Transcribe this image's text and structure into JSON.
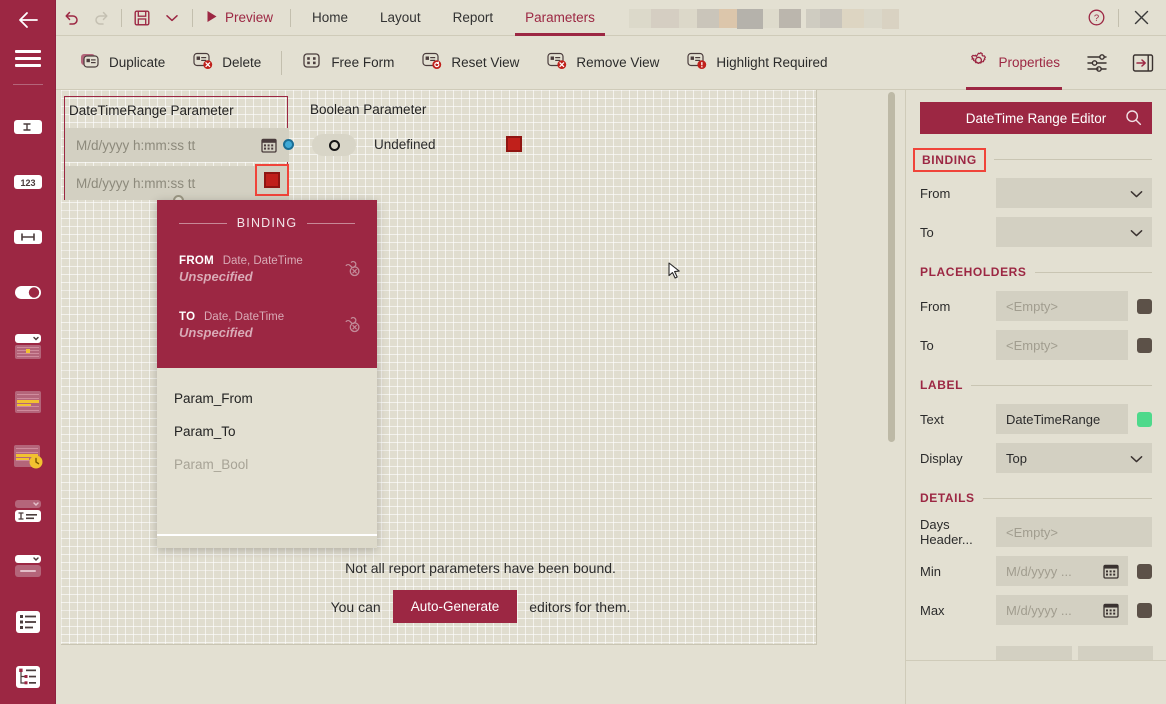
{
  "titlebar": {
    "back_icon": "back-arrow-icon",
    "undo_icon": "undo-icon",
    "redo_icon": "redo-icon",
    "save_icon": "save-icon",
    "save_dropdown_icon": "chevron-down-icon",
    "preview_label": "Preview",
    "preview_icon": "play-icon",
    "tabs": [
      {
        "label": "Home",
        "active": false
      },
      {
        "label": "Layout",
        "active": false
      },
      {
        "label": "Report",
        "active": false
      },
      {
        "label": "Parameters",
        "active": true
      }
    ],
    "help_icon": "help-circle-icon",
    "close_icon": "close-icon"
  },
  "ribbon": {
    "items": [
      {
        "label": "Duplicate",
        "icon": "duplicate-parameter-icon",
        "accent": false
      },
      {
        "label": "Delete",
        "icon": "delete-parameter-icon",
        "accent": false
      },
      {
        "label": "Free Form",
        "icon": "free-form-icon",
        "accent": false
      },
      {
        "label": "Reset View",
        "icon": "reset-view-icon",
        "accent": false
      },
      {
        "label": "Remove View",
        "icon": "remove-view-icon",
        "accent": false
      },
      {
        "label": "Highlight Required",
        "icon": "highlight-required-icon",
        "accent": false
      },
      {
        "label": "Properties",
        "icon": "gear-icon",
        "accent": true
      }
    ],
    "settings_icon": "sliders-icon",
    "collapse_panel_icon": "collapse-panel-icon"
  },
  "sidebar": {
    "menu_icon": "hamburger-icon",
    "items": [
      {
        "name": "text-parameter-icon"
      },
      {
        "name": "number-parameter-icon"
      },
      {
        "name": "range-parameter-icon"
      },
      {
        "name": "boolean-toggle-parameter-icon"
      },
      {
        "name": "date-picker-parameter-icon"
      },
      {
        "name": "date-range-parameter-icon"
      },
      {
        "name": "datetime-parameter-icon"
      },
      {
        "name": "combo-text-parameter-icon"
      },
      {
        "name": "dropdown-parameter-icon"
      },
      {
        "name": "list-parameter-icon"
      },
      {
        "name": "tree-list-parameter-icon"
      }
    ]
  },
  "canvas": {
    "range_widget": {
      "title": "DateTimeRange Parameter",
      "from_placeholder": "M/d/yyyy h:mm:ss tt",
      "to_placeholder": "M/d/yyyy h:mm:ss tt",
      "calendar_icon": "calendar-icon",
      "selected_swatch_icon": "color-swatch-icon"
    },
    "bool_widget": {
      "title": "Boolean Parameter",
      "state_label": "Undefined",
      "toggle_icon": "toggle-undefined-icon",
      "swatch_icon": "color-swatch-icon"
    },
    "message": {
      "line1": "Not all report parameters have been bound.",
      "prefix": "You can",
      "button": "Auto-Generate",
      "suffix": "editors for them."
    },
    "cursor_icon": "mouse-pointer-icon"
  },
  "popup": {
    "header": "BINDING",
    "rows": [
      {
        "kind": "FROM",
        "type": "Date, DateTime",
        "value": "Unspecified",
        "icon": "unlink-icon"
      },
      {
        "kind": "TO",
        "type": "Date, DateTime",
        "value": "Unspecified",
        "icon": "unlink-icon"
      }
    ],
    "options": [
      {
        "label": "Param_From",
        "disabled": false
      },
      {
        "label": "Param_To",
        "disabled": false
      },
      {
        "label": "Param_Bool",
        "disabled": true
      }
    ]
  },
  "properties": {
    "title": "DateTime Range Editor",
    "search_icon": "magnifier-icon",
    "sections": [
      {
        "name": "BINDING",
        "highlighted": true,
        "rows": [
          {
            "label": "From",
            "value": "",
            "control": "select",
            "icon": "chevron-down-icon",
            "swatch": null
          },
          {
            "label": "To",
            "value": "",
            "control": "select",
            "icon": "chevron-down-icon",
            "swatch": null
          }
        ]
      },
      {
        "name": "PLACEHOLDERS",
        "highlighted": false,
        "rows": [
          {
            "label": "From",
            "value": "<Empty>",
            "control": "text",
            "placeholder": true,
            "swatch": "#5C5148"
          },
          {
            "label": "To",
            "value": "<Empty>",
            "control": "text",
            "placeholder": true,
            "swatch": "#5C5148"
          }
        ]
      },
      {
        "name": "LABEL",
        "highlighted": false,
        "rows": [
          {
            "label": "Text",
            "value": "DateTimeRange",
            "control": "text",
            "placeholder": false,
            "swatch": "#4ED98B"
          },
          {
            "label": "Display",
            "value": "Top",
            "control": "select",
            "icon": "chevron-down-icon",
            "swatch": null
          }
        ]
      },
      {
        "name": "DETAILS",
        "highlighted": false,
        "rows": [
          {
            "label": "Days Header...",
            "value": "<Empty>",
            "control": "text",
            "placeholder": true,
            "swatch": null
          },
          {
            "label": "Min",
            "value": "M/d/yyyy ...",
            "control": "date",
            "placeholder": true,
            "icon": "calendar-icon",
            "swatch": "#5C5148"
          },
          {
            "label": "Max",
            "value": "M/d/yyyy ...",
            "control": "date",
            "placeholder": true,
            "icon": "calendar-icon",
            "swatch": "#5C5148"
          }
        ]
      }
    ]
  },
  "colors": {
    "accent": "#9C2743",
    "panel_bg": "#E3E0D2",
    "control_bg": "#D3D0C2",
    "selection_red": "#F0443A",
    "swatch_red": "#C0201B",
    "swatch_green": "#4ED98B",
    "swatch_dark": "#5C5148",
    "anchor_blue": "#3FA9D6"
  }
}
